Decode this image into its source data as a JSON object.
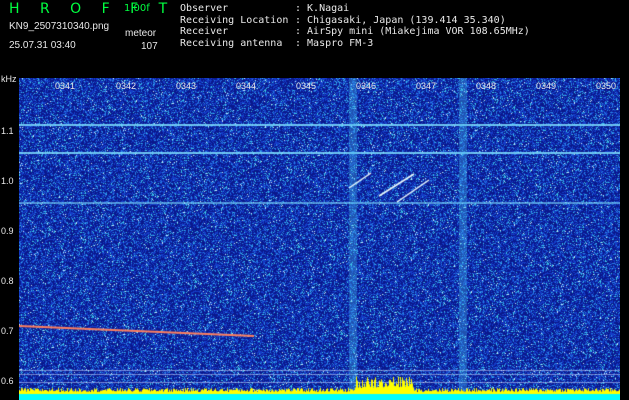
{
  "header": {
    "app_logo": "H R O F F T",
    "version": "1.00f",
    "filename": "KN9_2507310340.png",
    "datetime": "25.07.31 03:40",
    "meteor_label": "meteor",
    "meteor_count": "107",
    "info": [
      {
        "key": "Observer",
        "value": ": K.Nagai"
      },
      {
        "key": "Receiving Location",
        "value": ": Chigasaki, Japan (139.414 35.340)"
      },
      {
        "key": "Receiver",
        "value": ": AirSpy mini (Miakejima VOR 108.65MHz)"
      },
      {
        "key": "Receiving antenna",
        "value": ": Maspro FM-3"
      }
    ]
  },
  "spectrogram": {
    "y_unit": "kHz",
    "y_ticks": [
      "1.1",
      "1.0",
      "0.9",
      "0.8",
      "0.7",
      "0.6"
    ],
    "time_ticks": [
      "0341",
      "0342",
      "0343",
      "0344",
      "0345",
      "0346",
      "0347",
      "0348",
      "0349",
      "0350"
    ]
  },
  "colors": {
    "background_noise": "#0a1a8c",
    "carrier_line": "#7fe0ff",
    "meteor_trail": "#ffffff",
    "level_bar": "#ffff00",
    "level_base": "#00ffff"
  }
}
